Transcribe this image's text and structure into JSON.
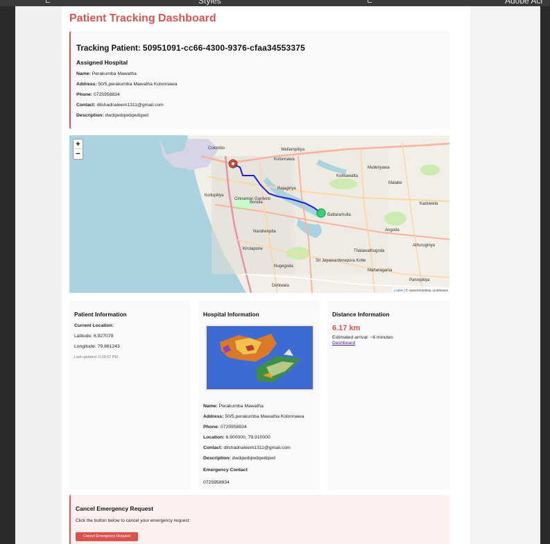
{
  "chrome": {
    "tab_left": "Styles",
    "tab_right": "Adobe Acr"
  },
  "dashboard": {
    "title": "Patient Tracking Dashboard"
  },
  "tracking": {
    "label": "Tracking Patient:",
    "patient_id": "50951091-cc66-4300-9376-cfaa34553375",
    "assigned_hospital_heading": "Assigned Hospital",
    "name_label": "Name:",
    "name": "Perakumba Mawatha",
    "address_label": "Address:",
    "address": "50/5,perakumba Mawatha Kolonnawa",
    "phone_label": "Phone:",
    "phone": "0725958834",
    "contact_label": "Contact:",
    "contact": "dilshadnaleem1311@gmail.com",
    "description_label": "Description:",
    "description": "dwdqwdqwdqwdqwd"
  },
  "map": {
    "zoom_in": "+",
    "zoom_out": "−",
    "attribution_leaflet": "Leaflet",
    "attribution_osm": "| © OpenStreetMap contributors",
    "labels": {
      "colombo": "Colombo",
      "kolonnawa": "Kolonnawa",
      "wellampitiya": "Wellampitiya",
      "kotte": "Sri Jayawardenepura Kotte",
      "battaramulla": "Battaramulla",
      "dehiwala": "Dehiwala",
      "nugegoda": "Nugegoda",
      "maharagama": "Maharagama",
      "borella": "Borella",
      "kirulapone": "Kirulapone",
      "malabe": "Malabe",
      "thalawathugoda": "Thalawathugoda",
      "cinnamon_gardens": "Cinnamon Gardens",
      "mulleriyawa": "Mulleriyawa",
      "kollupitiya": "Kollupitiya",
      "rajagiriya": "Rajagiriya",
      "narahenpita": "Narahenpita",
      "pannipitiya": "Pannipitiya",
      "kaduwela": "Kaduwela",
      "angoda": "Angoda",
      "kotikawatta": "Kotikawatta",
      "athurugiriya": "Athurugiriya"
    },
    "route_color": "#1f1fd6",
    "hospital_marker_color": "#2ecc71",
    "patient_marker_color": "#c0392b"
  },
  "patient_info": {
    "title": "Patient Information",
    "current_location_label": "Current Location:",
    "latitude_label": "Latitude:",
    "latitude": "6.927079",
    "longitude_label": "Longitude:",
    "longitude": "79.861243",
    "last_updated": "Last updated: 5:29:57 PM"
  },
  "hospital_info": {
    "title": "Hospital Information",
    "name_label": "Name:",
    "name": "Perakumba Mawatha",
    "address_label": "Address:",
    "address": "50/5,perakumba Mawatha Kolonnawa",
    "phone_label": "Phone:",
    "phone": "0725958834",
    "location_label": "Location:",
    "location": "6.900000, 79.910000",
    "contact_label": "Contact:",
    "contact": "dilshadnaleem1311@gmail.com",
    "description_label": "Description:",
    "description": "dwdqwdqwdqwdqwd",
    "emergency_contact_heading": "Emergency Contact",
    "emergency_contact": "0725958834"
  },
  "distance_info": {
    "title": "Distance Information",
    "distance": "6.17 km",
    "eta": "Estimated arrival: ~6 minutes",
    "dashboard_link": "Dashboard"
  },
  "cancel": {
    "title": "Cancel Emergency Request",
    "text": "Click the button below to cancel your emergency request:",
    "button": "Cancel Emergency Request"
  },
  "colors": {
    "accent": "#d9534f",
    "panel_bg": "#f8f9fa",
    "cancel_bg": "#fdf0ef",
    "link": "#551a8b"
  }
}
